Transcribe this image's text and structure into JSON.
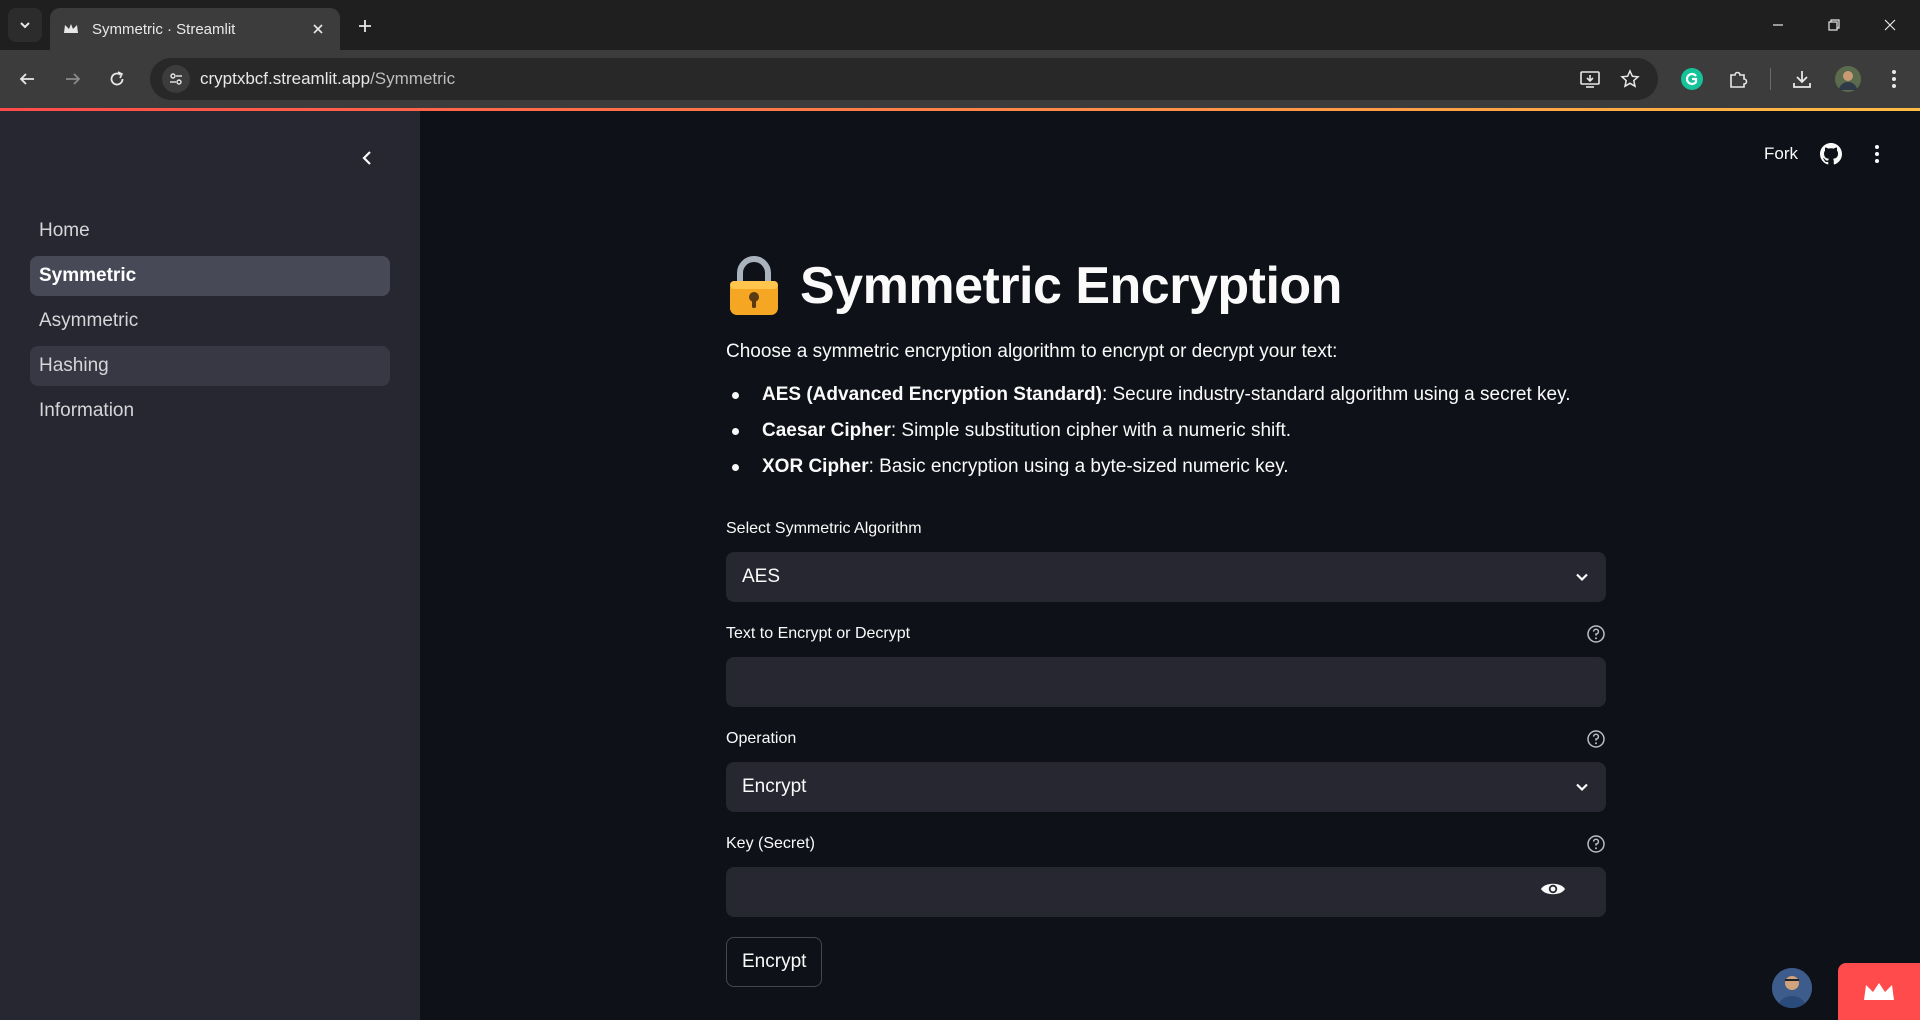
{
  "browser": {
    "tab_title": "Symmetric · Streamlit",
    "url_host": "cryptxbcf.streamlit.app",
    "url_path": "/Symmetric"
  },
  "sidebar": {
    "items": [
      {
        "label": "Home",
        "state": "normal"
      },
      {
        "label": "Symmetric",
        "state": "active"
      },
      {
        "label": "Asymmetric",
        "state": "normal"
      },
      {
        "label": "Hashing",
        "state": "hover"
      },
      {
        "label": "Information",
        "state": "normal"
      }
    ]
  },
  "header": {
    "fork_label": "Fork"
  },
  "main": {
    "title": "Symmetric Encryption",
    "intro": "Choose a symmetric encryption algorithm to encrypt or decrypt your text:",
    "bullets": [
      {
        "term": "AES (Advanced Encryption Standard)",
        "desc": ": Secure industry-standard algorithm using a secret key."
      },
      {
        "term": "Caesar Cipher",
        "desc": ": Simple substitution cipher with a numeric shift."
      },
      {
        "term": "XOR Cipher",
        "desc": ": Basic encryption using a byte-sized numeric key."
      }
    ],
    "algorithm": {
      "label": "Select Symmetric Algorithm",
      "value": "AES"
    },
    "text_input": {
      "label": "Text to Encrypt or Decrypt",
      "value": ""
    },
    "operation": {
      "label": "Operation",
      "value": "Encrypt"
    },
    "key_input": {
      "label": "Key (Secret)",
      "value": ""
    },
    "submit_label": "Encrypt"
  },
  "colors": {
    "accent": "#ff4b4b",
    "background": "#0e1117",
    "sidebar_bg": "#262730",
    "widget_bg": "#262730"
  }
}
